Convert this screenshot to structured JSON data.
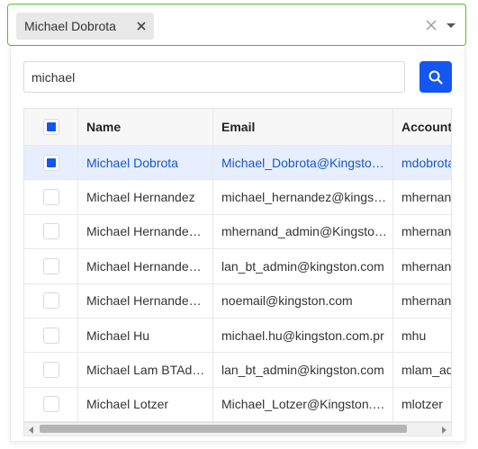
{
  "picker": {
    "selected_tag": "Michael Dobrota",
    "accent_color": "#52c41a"
  },
  "search": {
    "value": "michael",
    "button_color": "#1456f0"
  },
  "table": {
    "columns": [
      "Name",
      "Email",
      "Account"
    ],
    "rows": [
      {
        "name": "Michael Dobrota",
        "email": "Michael_Dobrota@Kingston.com",
        "account": "mdobrota",
        "selected": true
      },
      {
        "name": "Michael Hernandez",
        "email": "michael_hernandez@kingston.com",
        "account": "mhernandez",
        "selected": false
      },
      {
        "name": "Michael Hernandez Admin",
        "email": "mhernand_admin@Kingston.com",
        "account": "mhernand_admin",
        "selected": false
      },
      {
        "name": "Michael Hernandez BT Admin",
        "email": "lan_bt_admin@kingston.com",
        "account": "mhernand_bt",
        "selected": false
      },
      {
        "name": "Michael Hernandez Test",
        "email": "noemail@kingston.com",
        "account": "mhernand_test",
        "selected": false
      },
      {
        "name": "Michael Hu",
        "email": "michael.hu@kingston.com.pr",
        "account": "mhu",
        "selected": false
      },
      {
        "name": "Michael Lam BTAdmin",
        "email": "lan_bt_admin@kingston.com",
        "account": "mlam_admin",
        "selected": false
      },
      {
        "name": "Michael Lotzer",
        "email": "Michael_Lotzer@Kingston.com",
        "account": "mlotzer",
        "selected": false
      }
    ]
  }
}
